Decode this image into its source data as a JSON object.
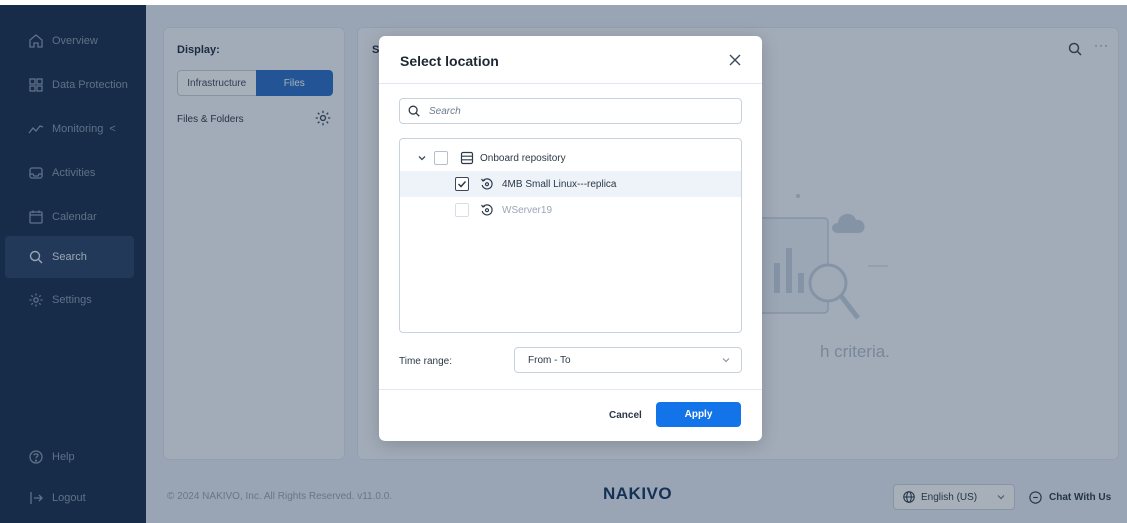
{
  "sidebar": {
    "items": [
      {
        "label": "Overview",
        "icon": "home-icon"
      },
      {
        "label": "Data Protection",
        "icon": "grid-icon"
      },
      {
        "label": "Monitoring",
        "icon": "trend-icon",
        "caret": "<"
      },
      {
        "label": "Activities",
        "icon": "inbox-icon"
      },
      {
        "label": "Calendar",
        "icon": "calendar-icon"
      },
      {
        "label": "Search",
        "icon": "search-icon",
        "active": true
      },
      {
        "label": "Settings",
        "icon": "gear-icon"
      }
    ],
    "bottom": [
      {
        "label": "Help",
        "icon": "help-icon"
      },
      {
        "label": "Logout",
        "icon": "logout-icon"
      }
    ]
  },
  "left_panel": {
    "display_label": "Display:",
    "seg_options": [
      "Infrastructure",
      "Files"
    ],
    "selected": "Files",
    "files_folders_label": "Files & Folders"
  },
  "main_panel": {
    "title_fragment": "S",
    "more": "···",
    "empty_text_fragment": "h criteria."
  },
  "footer": {
    "copyright": "© 2024 NAKIVO, Inc. All Rights Reserved. v11.0.0.",
    "logo": "NAKIVO",
    "language": "English (US)",
    "chat": "Chat With Us"
  },
  "modal": {
    "title": "Select location",
    "search_placeholder": "Search",
    "tree": {
      "root": {
        "label": "Onboard repository",
        "checked": false
      },
      "children": [
        {
          "label": "4MB Small Linux---replica",
          "checked": true,
          "enabled": true
        },
        {
          "label": "WServer19",
          "checked": false,
          "enabled": false
        }
      ]
    },
    "time_range_label": "Time range:",
    "time_range_value": "From - To",
    "cancel_label": "Cancel",
    "apply_label": "Apply"
  },
  "colors": {
    "sidebar_bg": "#152c4a",
    "accent": "#1274e8",
    "segment_active": "#2b6fc7"
  }
}
